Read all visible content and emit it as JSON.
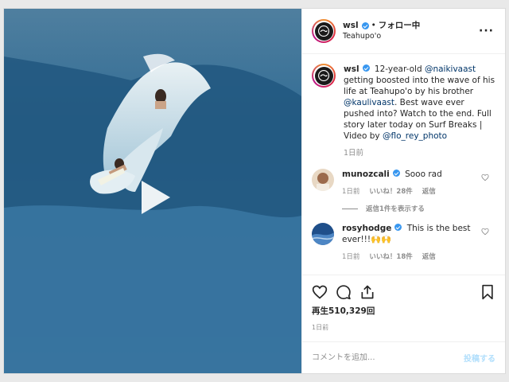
{
  "post": {
    "username": "wsl",
    "follow_separator": "•",
    "follow_label": "フォロー中",
    "location": "Teahupo'o",
    "more_icon": "more-horizontal-icon",
    "media": {
      "type": "video",
      "play_icon": "play-icon"
    }
  },
  "caption": {
    "username": "wsl",
    "parts": [
      {
        "t": "12-year-old "
      },
      {
        "t": "@naikivaast",
        "mention": true
      },
      {
        "t": " getting boosted into the wave of his life at Teahupo'o by his brother "
      },
      {
        "t": "@kaulivaast",
        "mention": true
      },
      {
        "t": ". Best wave ever pushed into? Watch to the end. Full story later today on Surf Breaks | Video by "
      },
      {
        "t": "@flo_rey_photo",
        "mention": true
      }
    ],
    "time": "1日前"
  },
  "comments": [
    {
      "username": "munozcali",
      "text": "Sooo rad",
      "time": "1日前",
      "likes": "いいね！28件",
      "reply_label": "返信",
      "view_replies": "返信1件を表示する"
    },
    {
      "username": "rosyhodge",
      "text": "This is the best ever!!!🙌🙌",
      "time": "1日前",
      "likes": "いいね！18件",
      "reply_label": "返信"
    }
  ],
  "footer": {
    "views": "再生510,329回",
    "date": "1日前",
    "comment_placeholder": "コメントを追加...",
    "post_label": "投稿する"
  },
  "colors": {
    "accent": "#3897f0",
    "mention": "#003569",
    "post_disabled": "#b2dffc",
    "muted": "#8e8e8e"
  }
}
